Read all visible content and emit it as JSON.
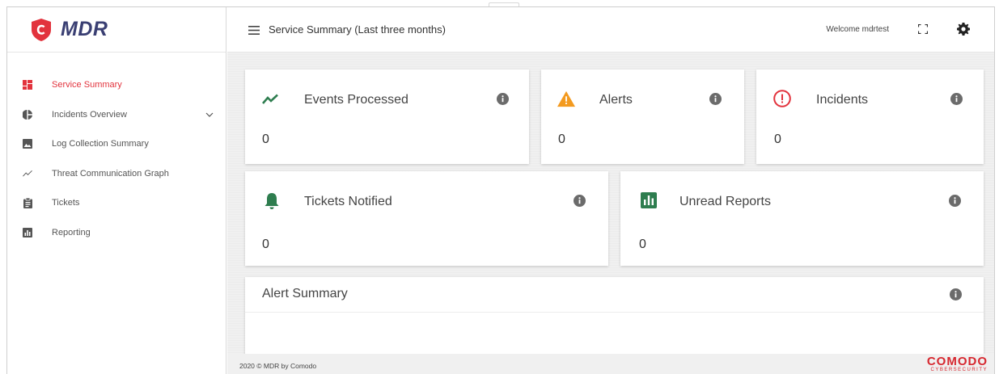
{
  "app": {
    "logo_text": "MDR"
  },
  "sidebar": {
    "items": [
      {
        "label": "Service Summary",
        "icon": "dashboard-icon",
        "active": true
      },
      {
        "label": "Incidents Overview",
        "icon": "pie-chart-icon",
        "expandable": true
      },
      {
        "label": "Log Collection Summary",
        "icon": "image-icon"
      },
      {
        "label": "Threat Communication Graph",
        "icon": "trend-line-icon"
      },
      {
        "label": "Tickets",
        "icon": "clipboard-icon"
      },
      {
        "label": "Reporting",
        "icon": "bar-chart-icon"
      }
    ]
  },
  "header": {
    "title": "Service Summary (Last three months)",
    "welcome": "Welcome mdrtest"
  },
  "cards": {
    "events_processed": {
      "title": "Events Processed",
      "value": "0",
      "icon": "trend-line-icon"
    },
    "alerts": {
      "title": "Alerts",
      "value": "0",
      "icon": "warning-icon"
    },
    "incidents": {
      "title": "Incidents",
      "value": "0",
      "icon": "alert-circle-icon"
    },
    "tickets_notified": {
      "title": "Tickets Notified",
      "value": "0",
      "icon": "bell-icon"
    },
    "unread_reports": {
      "title": "Unread Reports",
      "value": "0",
      "icon": "bar-chart-icon"
    },
    "alert_summary": {
      "title": "Alert Summary"
    }
  },
  "footer": {
    "copyright": "2020 © MDR by Comodo",
    "brand": "COMODO",
    "brand_sub": "CYBERSECURITY"
  },
  "colors": {
    "accent_red": "#e2333d",
    "logo_navy": "#3a3f73",
    "green": "#2e7d4f",
    "orange": "#f39a1f",
    "info_gray": "#6b6b6b"
  }
}
